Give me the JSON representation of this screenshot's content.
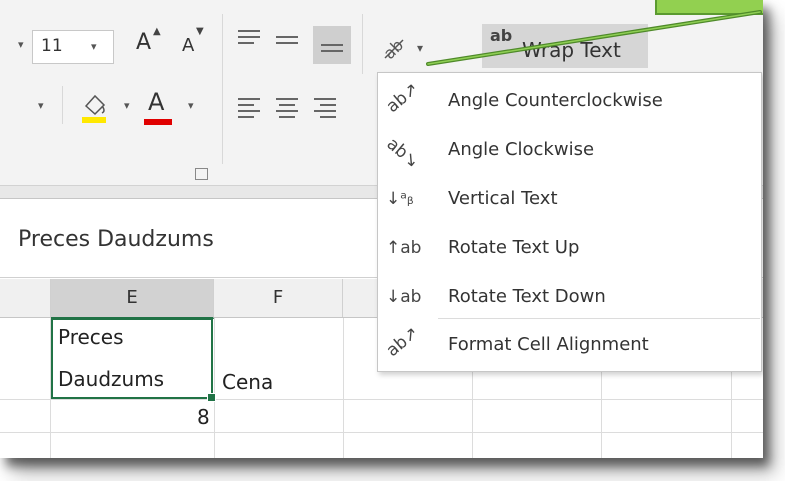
{
  "ribbon": {
    "font_size": "11",
    "grow_font_icon": "A",
    "shrink_font_icon": "A",
    "font_color_icon": "A",
    "wrap_text": {
      "icon": "ab",
      "label": "Wrap Text"
    }
  },
  "formula_bar": {
    "value": "Preces Daudzums"
  },
  "columns": [
    "E",
    "F"
  ],
  "cells": {
    "E_line1": "Preces",
    "E_line2": "Daudzums",
    "F": "Cena",
    "E_next": "8"
  },
  "orientation_menu": {
    "items": [
      {
        "label": "Angle Counterclockwise",
        "icon": "angle-counterclockwise-icon"
      },
      {
        "label": "Angle Clockwise",
        "icon": "angle-clockwise-icon"
      },
      {
        "label": "Vertical Text",
        "icon": "vertical-text-icon"
      },
      {
        "label": "Rotate Text Up",
        "icon": "rotate-text-up-icon"
      },
      {
        "label": "Rotate Text Down",
        "icon": "rotate-text-down-icon"
      },
      {
        "label": "Format Cell Alignment",
        "icon": "format-cell-alignment-icon"
      }
    ]
  },
  "colors": {
    "accent": "#217346",
    "fill_color": "#ffe800",
    "font_color": "#e00000",
    "callout": "#92d050",
    "arrow": "#4f8a2a"
  }
}
